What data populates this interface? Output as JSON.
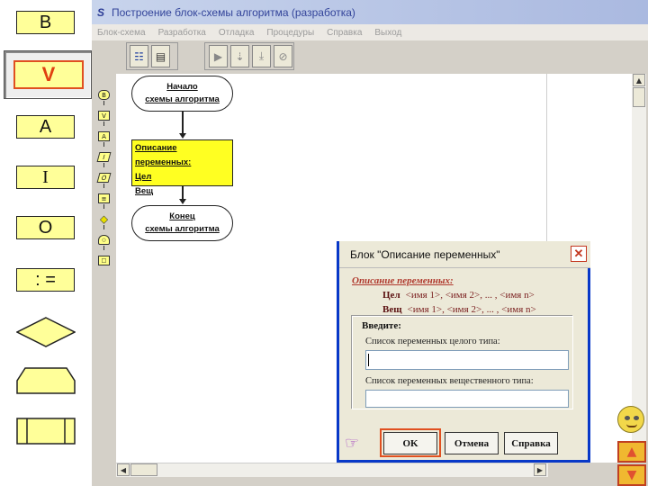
{
  "palette": {
    "items": [
      "B",
      "V",
      "A",
      "I",
      "O",
      ": ="
    ]
  },
  "window": {
    "title": "Построение блок-схемы алгоритма (разработка)",
    "app_icon": "S"
  },
  "menu": [
    "Блок-схема",
    "Разработка",
    "Отладка",
    "Процедуры",
    "Справка",
    "Выход"
  ],
  "block_palette": [
    "B",
    "V",
    "A",
    "I",
    "O",
    "≡",
    "◆",
    "○",
    "□"
  ],
  "flowchart": {
    "start": [
      "Начало",
      "схемы алгоритма"
    ],
    "declaration": [
      "Описание переменных:",
      "Цел",
      "Вещ"
    ],
    "end": [
      "Конец",
      "схемы алгоритма"
    ]
  },
  "dialog": {
    "title": "Блок \"Описание переменных\"",
    "decl_heading": "Описание переменных:",
    "decl_int_type": "Цел",
    "decl_int_list": "<имя 1>,  <имя 2>,  ... ,  <имя n>",
    "decl_real_type": "Вещ",
    "decl_real_list": "<имя 1>,  <имя 2>,  ... ,  <имя n>",
    "group_title": "Введите:",
    "int_label": "Список переменных целого типа:",
    "int_value": "",
    "real_label": "Список переменных вещественного типа:",
    "real_value": "",
    "ok_label": "OK",
    "cancel_label": "Отмена",
    "help_label": "Справка"
  },
  "colors": {
    "palette_fill": "#ffff99",
    "selection_outline": "#e05020",
    "declaration_fill": "#ffff22",
    "dialog_border": "#0838c8",
    "title_text": "#33449a"
  }
}
